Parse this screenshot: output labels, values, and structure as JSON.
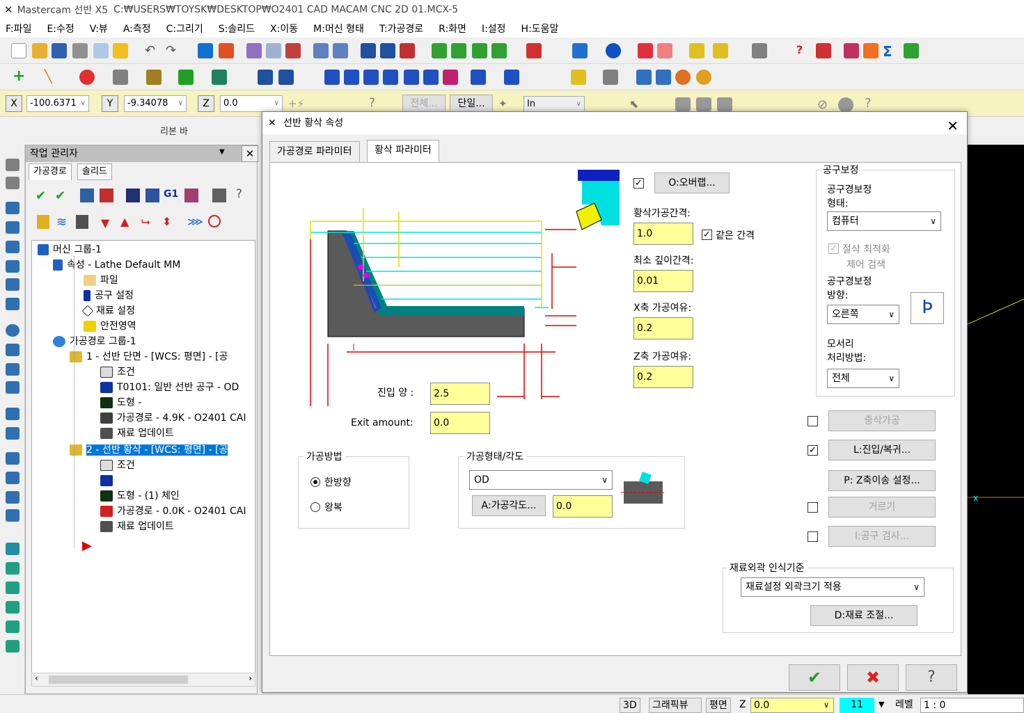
{
  "window": {
    "app_name": "Mastercam 선반 X5",
    "file_path": "C:₩USERS₩TOYSK₩DESKTOP₩O2401 CAD MACAM CNC 2D 01.MCX-5"
  },
  "menu": [
    "F:파일",
    "E:수정",
    "V:뷰",
    "A:측정",
    "C:그리기",
    "S:솔리드",
    "X:이동",
    "M:머신 형태",
    "T:가공경로",
    "R:화면",
    "I:설정",
    "H:도움말"
  ],
  "coords": {
    "x_label": "X",
    "x_value": "-100.6371",
    "y_label": "Y",
    "y_value": "-9.34078",
    "z_label": "Z",
    "z_value": "0.0",
    "all_btn": "전체...",
    "single_btn": "단일...",
    "unit": "In"
  },
  "ribbon_label": "리본 바",
  "op_manager": {
    "title": "작업 관리자",
    "tabs": [
      "가공경로",
      "솔리드"
    ],
    "tree": [
      "머신 그룹-1",
      "속성 - Lathe Default MM",
      "파일",
      "공구 설정",
      "재료 설정",
      "안전영역",
      "가공경로 그룹-1",
      "1 - 선반 단면 - [WCS: 평면] - [공",
      "조건",
      "T0101: 일반 선반 공구 - OD",
      "도형 -",
      "가공경로 - 4.9K - O2401 CAI",
      "재료 업데이트",
      "2 - 선반 황삭 - [WCS: 평면] - [공",
      "조건",
      "",
      "도형 - (1) 체인",
      "가공경로 - 0.0K - O2401 CAI",
      "재료 업데이트"
    ],
    "toolbar_g1": "G1"
  },
  "dialog": {
    "title": "선반 황삭 속성",
    "tabs": [
      "가공경로 파라미터",
      "황삭 파라미터"
    ],
    "overlap_btn": "O:오버랩...",
    "rough_step_label": "황삭가공간격:",
    "rough_step_value": "1.0",
    "equal_step_label": "같은 간격",
    "min_depth_label": "최소 깊이간격:",
    "min_depth_value": "0.01",
    "x_stock_label": "X축 가공여유:",
    "x_stock_value": "0.2",
    "z_stock_label": "Z축 가공여유:",
    "z_stock_value": "0.2",
    "entry_label": "진입 양 :",
    "entry_value": "2.5",
    "exit_label": "Exit amount:",
    "exit_value": "0.0",
    "method_group": "가공방법",
    "method_one": "한방향",
    "method_zig": "왕복",
    "shape_group": "가공형태/각도",
    "shape_value": "OD",
    "angle_btn": "A:가공각도...",
    "angle_value": "0.0",
    "comp_group": "공구보정",
    "comp_type_label1": "공구경보정",
    "comp_type_label2": "형태:",
    "comp_type_value": "컴퓨터",
    "optimize_label1": "절삭 최적화",
    "optimize_label2": "제어 검색",
    "comp_dir_label1": "공구경보정",
    "comp_dir_label2": "방향:",
    "comp_dir_value": "오른쪽",
    "corner_label1": "모서리",
    "corner_label2": "처리방법:",
    "corner_value": "전체",
    "plunge_btn": "중삭가공",
    "leadin_btn": "L:진입/복귀...",
    "zshift_btn": "P: Z축이송 설정...",
    "filter_btn": "거르기",
    "toolcheck_btn": "I:공구 검사...",
    "stock_group": "재료외곽 인식기준",
    "stock_value": "재료설정 외곽크기 적용",
    "stock_btn": "D:재료 조절..."
  },
  "status": {
    "btn_3d": "3D",
    "graphic_view": "그래픽뷰",
    "plane": "평면",
    "z_label": "Z",
    "z_value": "0.0",
    "color_value": "11",
    "level_label": "레벨",
    "level_value": "1 : 0"
  },
  "colors": {
    "input_yellow": "#ffff99",
    "selection_blue": "#0078d7",
    "part_teal": "#008080",
    "dim_red": "#e00000"
  }
}
